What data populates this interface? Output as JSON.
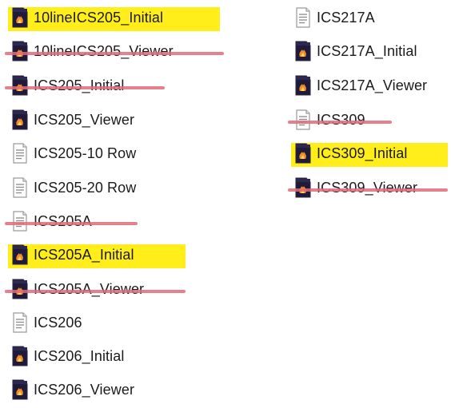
{
  "explorer": {
    "left_column": [
      {
        "name": "10lineICS205_Initial",
        "icon": "pdf-doc-icon",
        "highlight": "#ffee1a"
      },
      {
        "name": "10lineICS205_Viewer",
        "icon": "pdf-doc-icon",
        "strikethrough": "#e06b78"
      },
      {
        "name": "ICS205_Initial",
        "icon": "pdf-doc-icon",
        "strikethrough": "#e06b78"
      },
      {
        "name": "ICS205_Viewer",
        "icon": "pdf-doc-icon"
      },
      {
        "name": "ICS205-10 Row",
        "icon": "text-doc-icon"
      },
      {
        "name": "ICS205-20 Row",
        "icon": "text-doc-icon"
      },
      {
        "name": "ICS205A",
        "icon": "text-doc-icon",
        "strikethrough": "#e06b78"
      },
      {
        "name": "ICS205A_Initial",
        "icon": "pdf-doc-icon",
        "highlight": "#ffee1a"
      },
      {
        "name": "ICS205A_Viewer",
        "icon": "pdf-doc-icon",
        "strikethrough": "#e06b78"
      },
      {
        "name": "ICS206",
        "icon": "text-doc-icon"
      },
      {
        "name": "ICS206_Initial",
        "icon": "pdf-doc-icon"
      },
      {
        "name": "ICS206_Viewer",
        "icon": "pdf-doc-icon"
      }
    ],
    "right_column": [
      {
        "name": "ICS217A",
        "icon": "text-doc-icon"
      },
      {
        "name": "ICS217A_Initial",
        "icon": "pdf-doc-icon"
      },
      {
        "name": "ICS217A_Viewer",
        "icon": "pdf-doc-icon"
      },
      {
        "name": "ICS309",
        "icon": "text-doc-icon",
        "strikethrough": "#e06b78"
      },
      {
        "name": "ICS309_Initial",
        "icon": "pdf-doc-icon",
        "highlight": "#ffee1a"
      },
      {
        "name": "ICS309_Viewer",
        "icon": "pdf-doc-icon",
        "strikethrough": "#e06b78"
      }
    ]
  }
}
